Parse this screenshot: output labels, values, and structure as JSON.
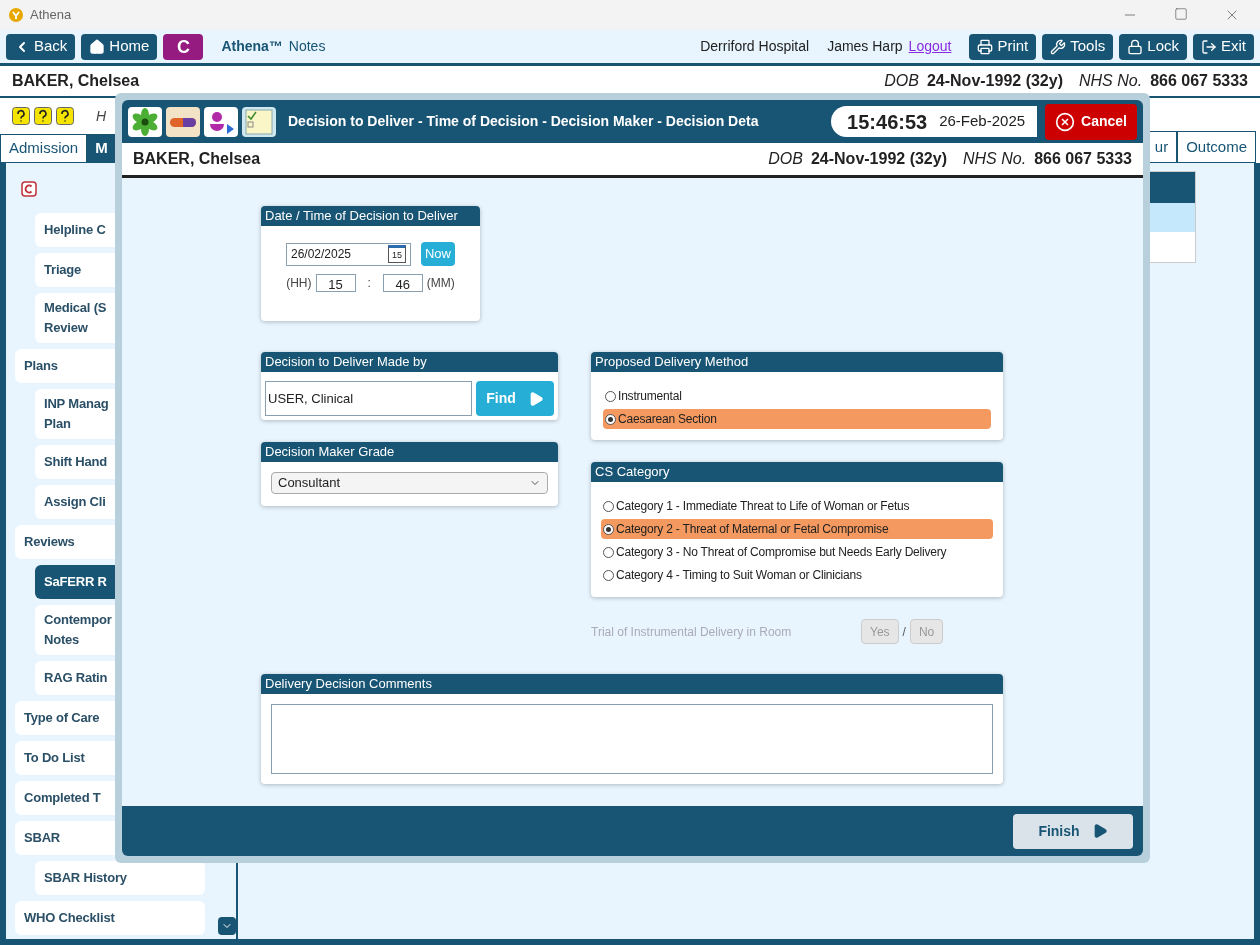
{
  "window": {
    "title": "Athena"
  },
  "toolbar": {
    "nav": [
      {
        "kind": "back",
        "label": "Back"
      },
      {
        "kind": "home",
        "label": "Home"
      },
      {
        "kind": "badge",
        "label": "C"
      }
    ],
    "app_name": "Athena™",
    "app_suffix": "Notes",
    "hospital": "Derriford Hospital",
    "user": "James Harp",
    "logout": "Logout",
    "actions": [
      {
        "kind": "print",
        "label": "Print"
      },
      {
        "kind": "tools",
        "label": "Tools"
      },
      {
        "kind": "lock",
        "label": "Lock"
      },
      {
        "kind": "exit",
        "label": "Exit"
      }
    ]
  },
  "patient": {
    "name": "BAKER, Chelsea",
    "dob_label": "DOB",
    "dob": "24-Nov-1992 (32y)",
    "nhs_label": "NHS No.",
    "nhs": "866 067 5333"
  },
  "hint_text": "H",
  "tabs_left": [
    {
      "label": "Admission",
      "selected": false
    },
    {
      "label": "M",
      "selected": true
    }
  ],
  "tabs_right": [
    {
      "label": "ur",
      "selected": false
    },
    {
      "label": "Outcome",
      "selected": false
    }
  ],
  "sidebar": {
    "first_group": [
      {
        "label": "Helpline C",
        "selected": false
      },
      {
        "label": "Triage",
        "selected": false
      },
      {
        "label": "Medical (S\nReview",
        "selected": false
      }
    ],
    "items": [
      {
        "label": "Plans",
        "selected": false,
        "children": [
          {
            "label": "INP Manag\nPlan",
            "selected": false
          },
          {
            "label": "Shift Hand",
            "selected": false
          },
          {
            "label": "Assign Cli",
            "selected": false
          }
        ]
      },
      {
        "label": "Reviews",
        "selected": false,
        "children": [
          {
            "label": "SaFERR R",
            "selected": true
          },
          {
            "label": "Contempor\nNotes",
            "selected": false
          },
          {
            "label": "RAG Ratin",
            "selected": false
          }
        ]
      },
      {
        "label": "Type of Care",
        "selected": false
      },
      {
        "label": "To Do List",
        "selected": false
      },
      {
        "label": "Completed T",
        "selected": false
      },
      {
        "label": "SBAR",
        "selected": false,
        "children": [
          {
            "label": "SBAR History",
            "selected": false
          }
        ]
      },
      {
        "label": "WHO Checklist",
        "selected": false
      }
    ]
  },
  "dialog": {
    "title": "Decision to Deliver - Time of Decision - Decision Maker - Decision Deta",
    "time": "15:46:53",
    "date": "26-Feb-2025",
    "cancel": "Cancel",
    "patient": {
      "name": "BAKER, Chelsea",
      "dob_label": "DOB",
      "dob": "24-Nov-1992 (32y)",
      "nhs_label": "NHS No.",
      "nhs": "866 067 5333"
    },
    "decision_time": {
      "title": "Date / Time of Decision to Deliver",
      "date": "26/02/2025",
      "calendar_day": "15",
      "now": "Now",
      "hh_label": "(HH)",
      "hh": "15",
      "separator": ":",
      "mm": "46",
      "mm_label": "(MM)"
    },
    "made_by": {
      "title": "Decision to Deliver Made by",
      "value": "USER, Clinical",
      "find": "Find"
    },
    "grade": {
      "title": "Decision Maker Grade",
      "value": "Consultant"
    },
    "delivery_method": {
      "title": "Proposed Delivery Method",
      "options": [
        {
          "label": "Instrumental",
          "selected": false
        },
        {
          "label": "Caesarean Section",
          "selected": true
        }
      ]
    },
    "cs_category": {
      "title": "CS Category",
      "options": [
        {
          "label": "Category 1 - Immediate Threat to Life of Woman or Fetus",
          "selected": false
        },
        {
          "label": "Category 2 - Threat of Maternal or Fetal Compromise",
          "selected": true
        },
        {
          "label": "Category 3 - No Threat of Compromise but Needs Early Delivery",
          "selected": false
        },
        {
          "label": "Category 4 - Timing to Suit Woman or Clinicians",
          "selected": false
        }
      ]
    },
    "trial": {
      "label": "Trial of Instrumental Delivery in Room",
      "yes": "Yes",
      "separator": "/",
      "no": "No",
      "disabled": true
    },
    "comments": {
      "title": "Delivery Decision Comments"
    },
    "finish": "Finish"
  }
}
